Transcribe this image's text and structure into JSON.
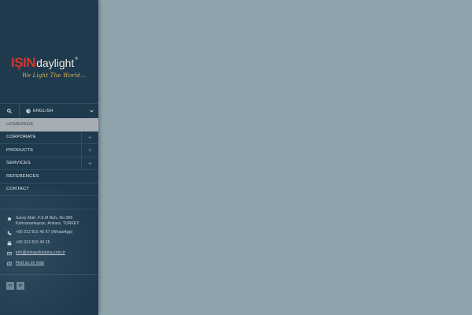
{
  "logo": {
    "brand_main": "IŞIN",
    "brand_sub": "daylight",
    "registered": "®",
    "slogan": "We Light The World..."
  },
  "toolbar": {
    "search_icon": "search-icon",
    "language_icon": "globe-icon",
    "language": "ENGLISH"
  },
  "menu": {
    "items": [
      {
        "label": "HOMEPAGE",
        "active": true,
        "expandable": false
      },
      {
        "label": "CORPORATE",
        "active": false,
        "expandable": true
      },
      {
        "label": "PRODUCTS",
        "active": false,
        "expandable": true
      },
      {
        "label": "SERVICES",
        "active": false,
        "expandable": true
      },
      {
        "label": "REFERENCES",
        "active": false,
        "expandable": false
      },
      {
        "label": "CONTACT",
        "active": false,
        "expandable": false
      }
    ],
    "expand_symbol": "+"
  },
  "contact": {
    "address_line1": "Saray Mah. F.S.M Bulv. No:365",
    "address_line2": "Kahramankazan, Ankara, TURKEY",
    "phone": "+90 312 815 46 67 (WhatsApp)",
    "fax": "+90 312 815 40 25",
    "email": "info@isinaydinlatma.com.tr",
    "map_link": "Find us on map"
  },
  "social": {
    "linkedin": "in",
    "email": "✉"
  },
  "colors": {
    "sidebar_bg": "#1f3a4d",
    "content_bg": "#8ea3ab",
    "brand_red": "#d9332b",
    "slogan_gold": "#d7b35a",
    "active_item_bg": "#a6aeb3"
  }
}
